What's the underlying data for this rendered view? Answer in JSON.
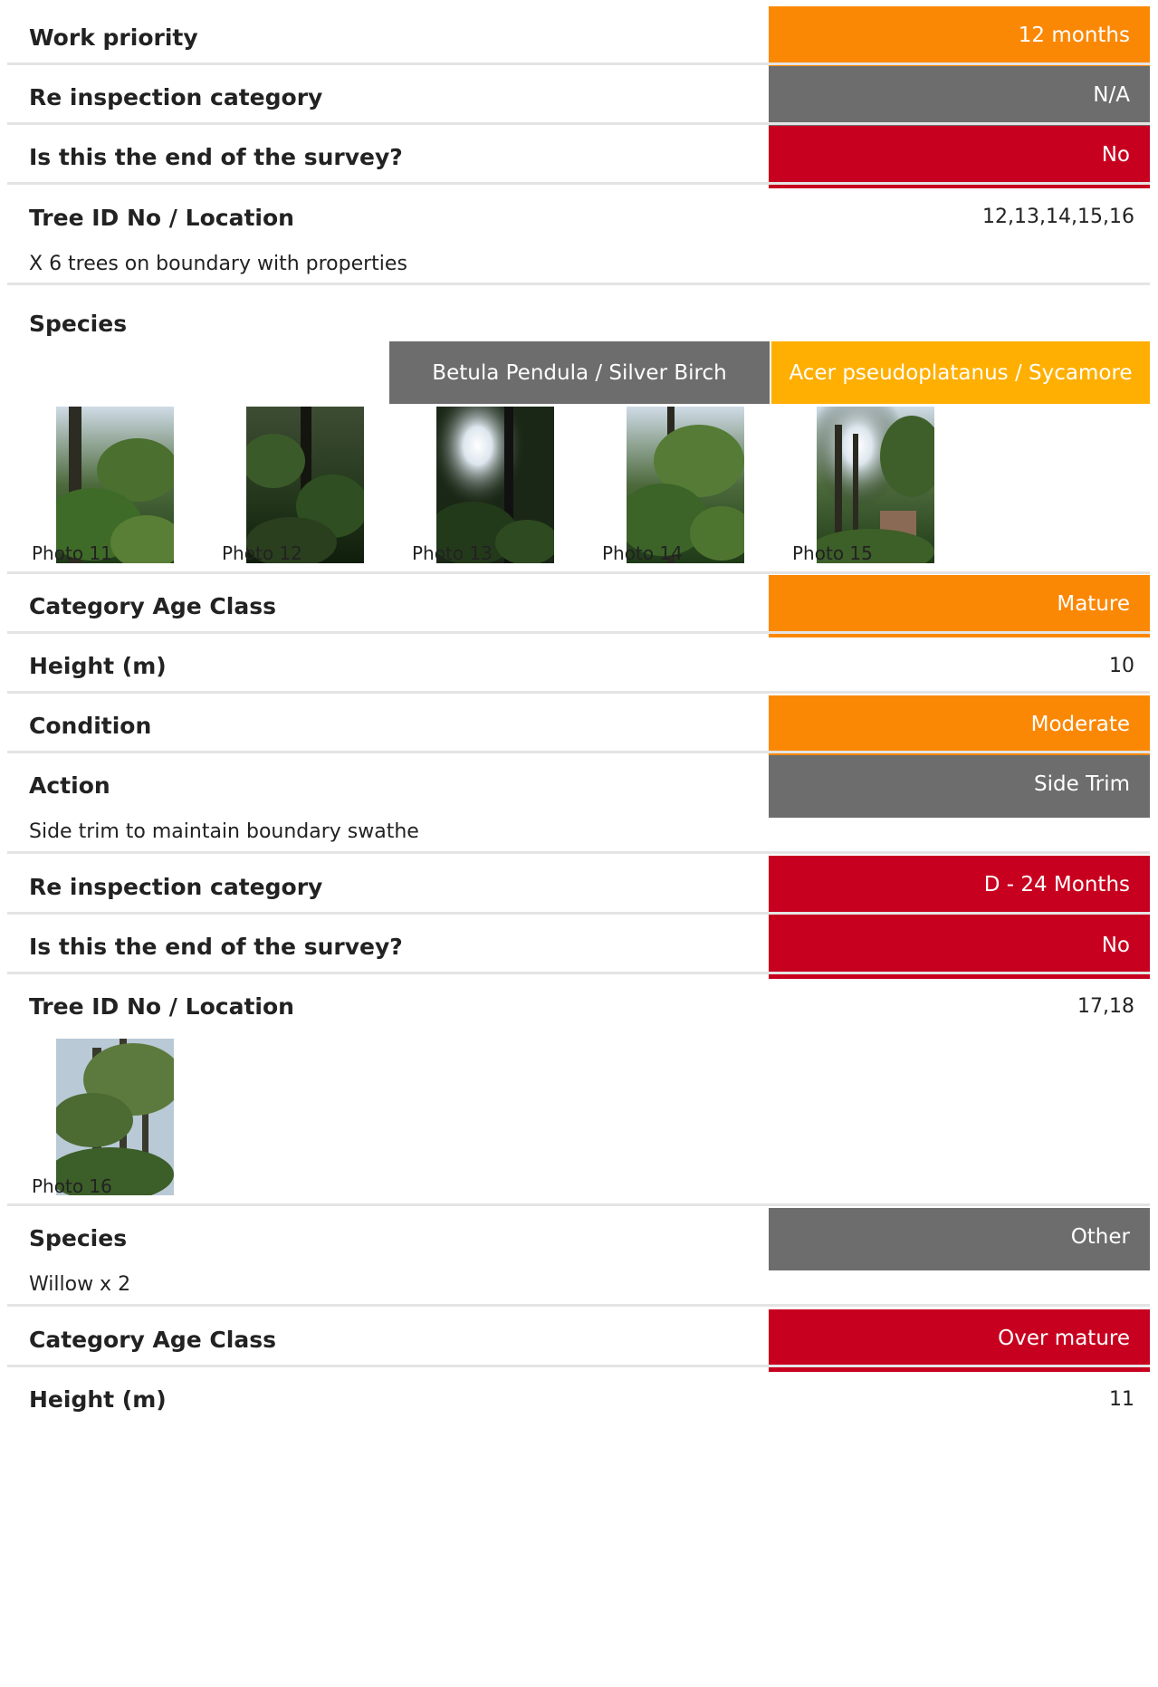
{
  "colors": {
    "orange": "#fb8805",
    "grey": "#6d6d6d",
    "red": "#c8001f",
    "amber": "#ffaf02",
    "divider": "#e4e4e4"
  },
  "section1": {
    "work_priority_label": "Work priority",
    "work_priority_value": "12 months",
    "reinspection_label": "Re inspection category",
    "reinspection_value": "N/A",
    "end_survey_label": "Is this the end of the survey?",
    "end_survey_value": "No"
  },
  "section2": {
    "tree_id_label": "Tree ID No / Location",
    "tree_id_value": "12,13,14,15,16",
    "location_note": "X 6 trees on boundary with properties",
    "species_label": "Species",
    "species_chips": [
      "Betula Pendula / Silver Birch",
      "Acer pseudoplatanus / Sycamore"
    ],
    "photos": [
      "Photo 11",
      "Photo 12",
      "Photo 13",
      "Photo 14",
      "Photo 15"
    ],
    "age_class_label": "Category Age Class",
    "age_class_value": "Mature",
    "height_label": "Height (m)",
    "height_value": "10",
    "condition_label": "Condition",
    "condition_value": "Moderate",
    "action_label": "Action",
    "action_value": "Side Trim",
    "action_note": "Side trim to maintain boundary swathe",
    "reinspection_label": "Re inspection category",
    "reinspection_value": "D - 24 Months",
    "end_survey_label": "Is this the end of the survey?",
    "end_survey_value": "No"
  },
  "section3": {
    "tree_id_label": "Tree ID No / Location",
    "tree_id_value": "17,18",
    "photos": [
      "Photo 16"
    ],
    "species_label": "Species",
    "species_value": "Other",
    "species_note": "Willow x 2",
    "age_class_label": "Category Age Class",
    "age_class_value": "Over mature",
    "height_label": "Height (m)",
    "height_value": "11"
  }
}
